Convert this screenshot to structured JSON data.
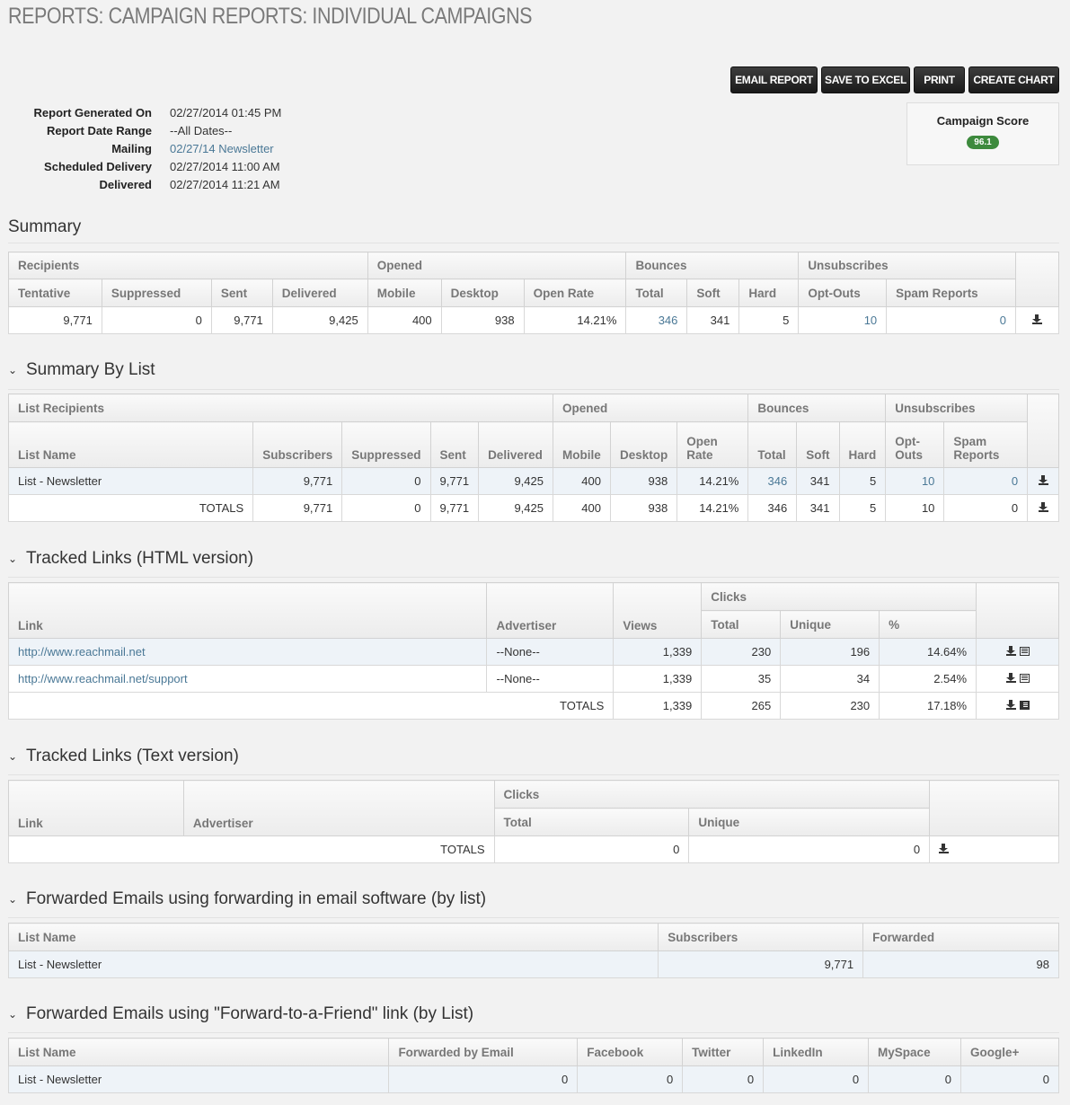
{
  "page": {
    "title": "REPORTS: CAMPAIGN REPORTS: INDIVIDUAL CAMPAIGNS"
  },
  "toolbar": {
    "email": "EMAIL REPORT",
    "excel": "SAVE TO EXCEL",
    "print": "PRINT",
    "chart": "CREATE CHART"
  },
  "meta": [
    {
      "key": "Report Generated On",
      "value": "02/27/2014 01:45 PM"
    },
    {
      "key": "Report Date Range",
      "value": "--All Dates--"
    },
    {
      "key": "Mailing",
      "value": "02/27/14 Newsletter"
    },
    {
      "key": "Scheduled Delivery",
      "value": "02/27/2014 11:00 AM"
    },
    {
      "key": "Delivered",
      "value": "02/27/2014 11:21 AM"
    }
  ],
  "score": {
    "title": "Campaign Score",
    "value": "96.1",
    "color": "#3d8a3d"
  },
  "summary": {
    "title": "Summary",
    "groups": {
      "recipients": "Recipients",
      "opened": "Opened",
      "bounces": "Bounces",
      "unsubscribes": "Unsubscribes"
    },
    "cols": [
      "Tentative",
      "Suppressed",
      "Sent",
      "Delivered",
      "Mobile",
      "Desktop",
      "Open Rate",
      "Total",
      "Soft",
      "Hard",
      "Opt-Outs",
      "Spam Reports"
    ],
    "row": [
      "9,771",
      "0",
      "9,771",
      "9,425",
      "400",
      "938",
      "14.21%",
      "346",
      "341",
      "5",
      "10",
      "0"
    ]
  },
  "by_list": {
    "title": "Summary By List",
    "groups": {
      "recipients": "List Recipients",
      "opened": "Opened",
      "bounces": "Bounces",
      "unsubscribes": "Unsubscribes"
    },
    "cols": [
      "List Name",
      "Subscribers",
      "Suppressed",
      "Sent",
      "Delivered",
      "Mobile",
      "Desktop",
      "Open Rate",
      "Total",
      "Soft",
      "Hard",
      "Opt-Outs",
      "Spam Reports"
    ],
    "rows": [
      [
        "List - Newsletter",
        "9,771",
        "0",
        "9,771",
        "9,425",
        "400",
        "938",
        "14.21%",
        "346",
        "341",
        "5",
        "10",
        "0"
      ],
      [
        "TOTALS",
        "9,771",
        "0",
        "9,771",
        "9,425",
        "400",
        "938",
        "14.21%",
        "346",
        "341",
        "5",
        "10",
        "0"
      ]
    ]
  },
  "links_html": {
    "title": "Tracked Links (HTML version)",
    "cols": {
      "link": "Link",
      "advertiser": "Advertiser",
      "views": "Views",
      "clicks": "Clicks",
      "total": "Total",
      "unique": "Unique",
      "pct": "%"
    },
    "rows": [
      {
        "link": "http://www.reachmail.net",
        "advertiser": "--None--",
        "views": "1,339",
        "total": "230",
        "unique": "196",
        "pct": "14.64%"
      },
      {
        "link": "http://www.reachmail.net/support",
        "advertiser": "--None--",
        "views": "1,339",
        "total": "35",
        "unique": "34",
        "pct": "2.54%"
      }
    ],
    "totals": {
      "label": "TOTALS",
      "views": "1,339",
      "total": "265",
      "unique": "230",
      "pct": "17.18%"
    }
  },
  "links_text": {
    "title": "Tracked Links (Text version)",
    "cols": {
      "link": "Link",
      "advertiser": "Advertiser",
      "clicks": "Clicks",
      "total": "Total",
      "unique": "Unique"
    },
    "totals": {
      "label": "TOTALS",
      "total": "0",
      "unique": "0"
    }
  },
  "fwd_software": {
    "title": "Forwarded Emails using forwarding in email software (by list)",
    "cols": {
      "list": "List Name",
      "subscribers": "Subscribers",
      "forwarded": "Forwarded"
    },
    "row": {
      "list": "List - Newsletter",
      "subscribers": "9,771",
      "forwarded": "98"
    }
  },
  "fwd_friend": {
    "title": "Forwarded Emails using \"Forward-to-a-Friend\" link (by List)",
    "cols": [
      "List Name",
      "Forwarded by Email",
      "Facebook",
      "Twitter",
      "LinkedIn",
      "MySpace",
      "Google+"
    ],
    "row": [
      "List - Newsletter",
      "0",
      "0",
      "0",
      "0",
      "0",
      "0"
    ]
  },
  "icons": {
    "chevron": "chevron-down-icon",
    "download": "download-icon",
    "list": "list-icon"
  }
}
